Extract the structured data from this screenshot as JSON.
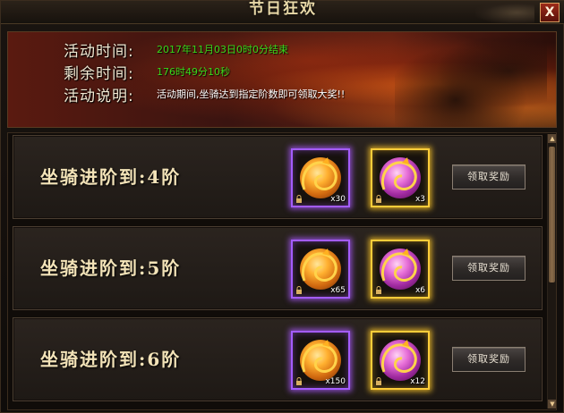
{
  "window": {
    "title": "节日狂欢",
    "close_label": "X"
  },
  "info": {
    "rows": [
      {
        "label": "活动时间:",
        "value": "2017年11月03日0时0分结束",
        "color": "green"
      },
      {
        "label": "剩余时间:",
        "value": "176时49分10秒",
        "color": "green"
      },
      {
        "label": "活动说明:",
        "value": "活动期间,坐骑达到指定阶数即可领取大奖!!",
        "color": "white"
      }
    ]
  },
  "rewards": {
    "rows": [
      {
        "title": "坐骑进阶到:4阶",
        "button_label": "领取奖励",
        "items": [
          {
            "icon": "orange-dragon-orb-icon",
            "quality": "purple",
            "locked": true,
            "quantity": "x30"
          },
          {
            "icon": "pink-dragon-orb-icon",
            "quality": "gold",
            "locked": true,
            "quantity": "x3"
          }
        ]
      },
      {
        "title": "坐骑进阶到:5阶",
        "button_label": "领取奖励",
        "items": [
          {
            "icon": "orange-dragon-orb-icon",
            "quality": "purple",
            "locked": true,
            "quantity": "x65"
          },
          {
            "icon": "pink-dragon-orb-icon",
            "quality": "gold",
            "locked": true,
            "quantity": "x6"
          }
        ]
      },
      {
        "title": "坐骑进阶到:6阶",
        "button_label": "领取奖励",
        "items": [
          {
            "icon": "orange-dragon-orb-icon",
            "quality": "purple",
            "locked": true,
            "quantity": "x150"
          },
          {
            "icon": "pink-dragon-orb-icon",
            "quality": "gold",
            "locked": true,
            "quantity": "x12"
          }
        ]
      }
    ]
  },
  "colors": {
    "info_value_green": "#39d71a",
    "purple_quality": "#a45cff",
    "gold_quality": "#ffcd3a",
    "close_button": "#9d2a18"
  },
  "scrollbar": {
    "up_icon": "arrow-up-icon",
    "down_icon": "arrow-down-icon"
  }
}
